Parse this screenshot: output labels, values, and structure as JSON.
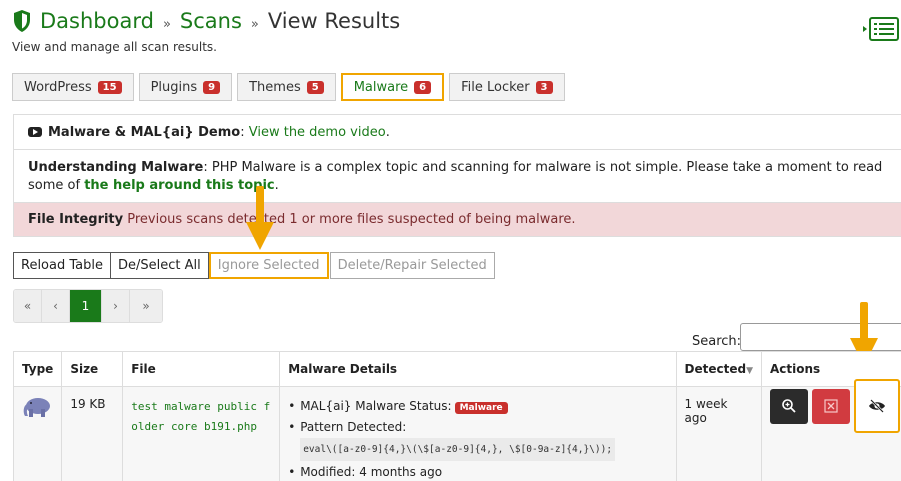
{
  "breadcrumb": {
    "dashboard": "Dashboard",
    "scans": "Scans",
    "current": "View Results",
    "sep": "»"
  },
  "subtitle": "View and manage all scan results.",
  "tabs": [
    {
      "label": "WordPress",
      "count": "15"
    },
    {
      "label": "Plugins",
      "count": "9"
    },
    {
      "label": "Themes",
      "count": "5"
    },
    {
      "label": "Malware",
      "count": "6"
    },
    {
      "label": "File Locker",
      "count": "3"
    }
  ],
  "info": {
    "demo_title": "Malware & MAL{ai} Demo",
    "demo_colon": ":",
    "demo_link": "View the demo video",
    "demo_after": ".",
    "understanding_title": "Understanding Malware",
    "understanding_text": ": PHP Malware is a complex topic and scanning for malware is not simple. Please take a moment to read some of ",
    "understanding_link": "the help around this topic",
    "understanding_after": ".",
    "integrity_title": "File Integrity",
    "integrity_text": " Previous scans detected 1 or more files suspected of being malware."
  },
  "buttons": {
    "reload": "Reload Table",
    "select_all": "De/Select All",
    "ignore": "Ignore Selected",
    "delete": "Delete/Repair Selected"
  },
  "pager": {
    "first": "«",
    "prev": "‹",
    "page": "1",
    "next": "›",
    "last": "»"
  },
  "search": {
    "label": "Search:",
    "value": ""
  },
  "table": {
    "headers": {
      "type": "Type",
      "size": "Size",
      "file": "File",
      "details": "Malware Details",
      "detected": "Detected",
      "actions": "Actions"
    },
    "rows": [
      {
        "type_icon": "php-elephant-icon",
        "size": "19 KB",
        "file": "test malware public folder core b191.php",
        "status_label": "MAL{ai} Malware Status:",
        "status_badge": "Malware",
        "pattern_label": "Pattern Detected:",
        "pattern": "eval\\([a-z0-9]{4,}\\(\\$[a-z0-9]{4,}, \\$[0-9a-z]{4,}\\));",
        "modified": "Modified: 4 months ago",
        "detected": "1 week ago"
      }
    ]
  },
  "colors": {
    "brand_green": "#1a7a1a",
    "danger_red": "#c9302c",
    "highlight": "#f0a500",
    "alert_bg": "#f2d7d9"
  }
}
